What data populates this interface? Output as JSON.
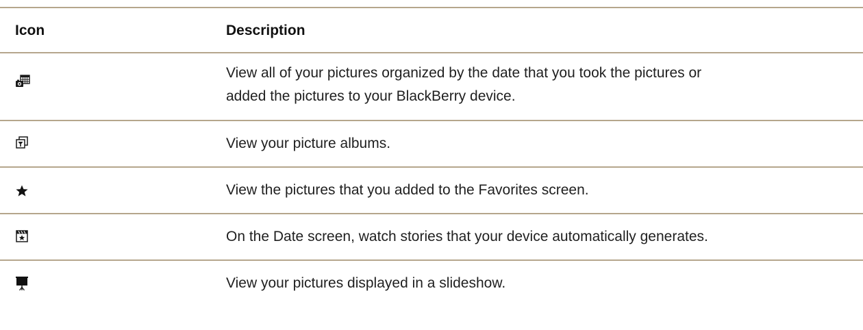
{
  "table": {
    "headers": {
      "icon": "Icon",
      "description": "Description"
    },
    "rows": [
      {
        "icon": "camera-calendar-icon",
        "description_lines": [
          "View all of your pictures organized by the date that you took the pictures or",
          "added the pictures to your BlackBerry device."
        ]
      },
      {
        "icon": "picture-albums-icon",
        "description_lines": [
          "View your picture albums."
        ]
      },
      {
        "icon": "star-icon",
        "description_lines": [
          "View the pictures that you added to the Favorites screen."
        ]
      },
      {
        "icon": "story-clapperboard-icon",
        "description_lines": [
          "On the Date screen, watch stories that your device automatically generates."
        ]
      },
      {
        "icon": "slideshow-projector-icon",
        "description_lines": [
          "View your pictures displayed in a slideshow."
        ]
      }
    ]
  },
  "colors": {
    "rule": "#b5a68c",
    "text": "#1f1f1f"
  }
}
